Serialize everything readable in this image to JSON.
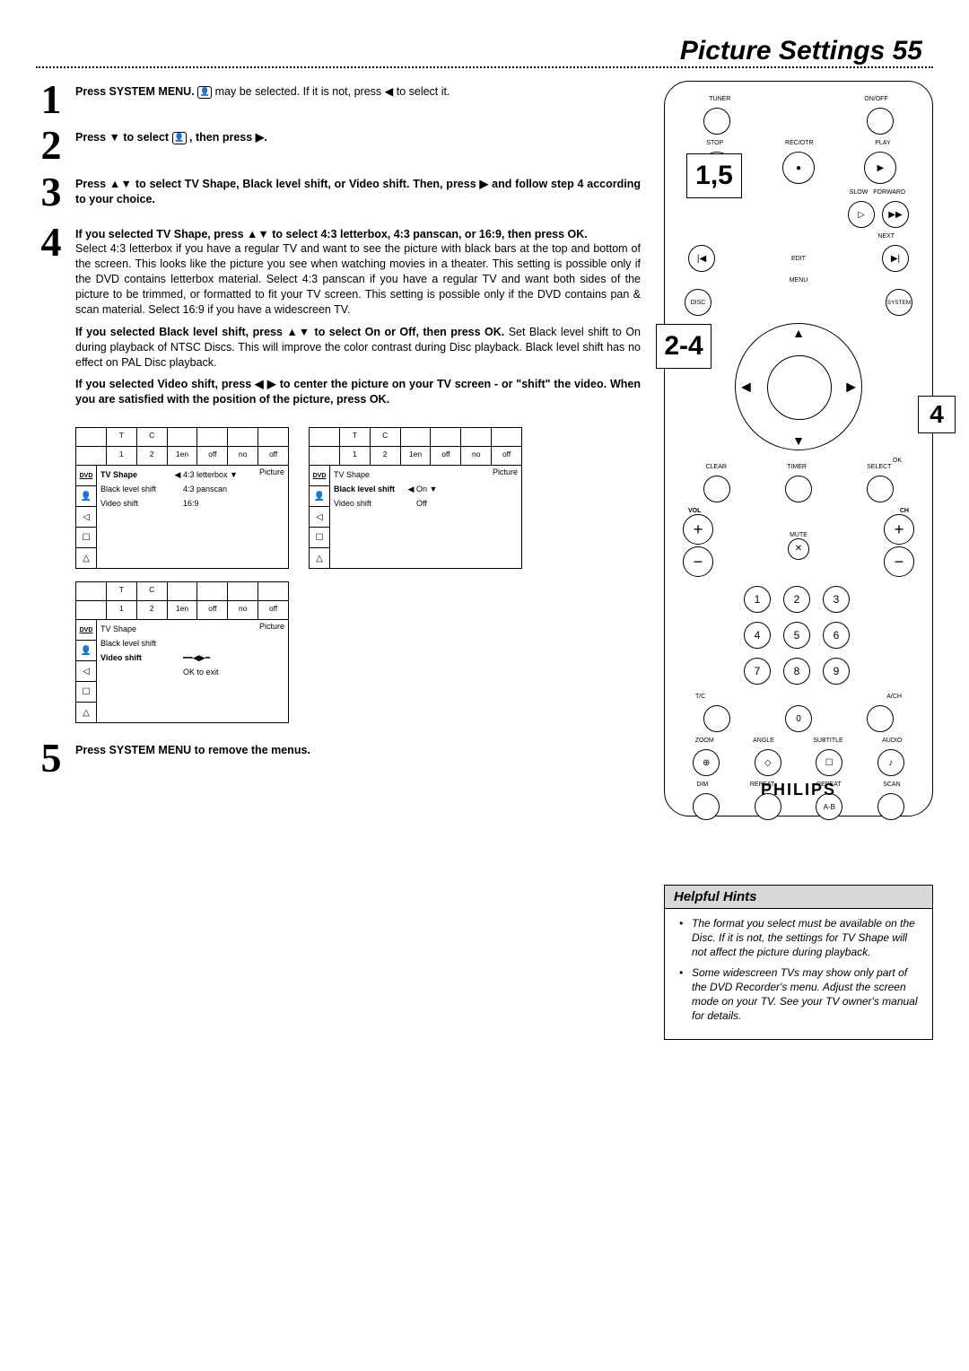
{
  "header": {
    "title": "Picture Settings",
    "page_number": "55"
  },
  "steps": {
    "s1": {
      "num": "1",
      "lead": "Press SYSTEM MENU.",
      "icon_name": "person-icon",
      "mid": " may be selected. If it is not, press ",
      "arrow": "◀",
      "tail": " to select it."
    },
    "s2": {
      "num": "2",
      "lead1": "Press ",
      "arrow1": "▼",
      "mid1": " to select ",
      "icon_box": "👤",
      "mid2": " , then press ",
      "arrow2": "▶",
      "tail": "."
    },
    "s3": {
      "num": "3",
      "lead": "Press ",
      "arrows": "▲▼",
      "mid1": " to select TV Shape, Black level shift, or Video shift. Then, press ",
      "arrow_r": "▶",
      "tail": " and follow step 4 according to your choice."
    },
    "s4": {
      "num": "4",
      "p1_lead": "If you selected TV Shape, press ",
      "p1_arrows": "▲▼",
      "p1_mid": " to select 4:3 letter­box, 4:3 panscan, or 16:9, then press OK.",
      "p1_body": "Select 4:3 letterbox if you have a regular TV and want to see the picture with black bars at the top and bottom of the screen. This looks like the picture you see when watching movies in a theater. This setting is possible only if the DVD contains letterbox material. Select 4:3 panscan if you have a regular TV and want both sides of the picture to be trimmed, or formatted to fit your TV screen. This setting is possible only if the DVD contains pan & scan material. Select 16:9 if you have a widescreen TV.",
      "p2_lead": "If you selected Black level shift, press ",
      "p2_arrows": "▲▼",
      "p2_mid": " to select On or Off, then press OK.",
      "p2_body": " Set Black level shift to On during playback of NTSC Discs. This will improve the color contrast during Disc play­back. Black level shift has no effect on PAL Disc playback.",
      "p3_lead": "If you selected Video shift, press ",
      "p3_arrows": "◀ ▶",
      "p3_mid": " to center the pic­ture on your TV screen - or \"shift\" the video. When you are satisfied with the position of the picture, press OK."
    },
    "s5": {
      "num": "5",
      "text": "Press SYSTEM MENU to remove the menus."
    }
  },
  "menu_top_cells": {
    "c1": "",
    "c2": "T",
    "c3": "C",
    "c4": "",
    "c5": "",
    "c6": "",
    "c7": ""
  },
  "menu_top_row2": {
    "c1": "",
    "c2": "1",
    "c3": "2",
    "c4": "1en",
    "c5": "off",
    "c6": "no",
    "c7": "off"
  },
  "menu_picture": "Picture",
  "menu1": {
    "items": [
      {
        "label": "TV Shape",
        "selected": true,
        "arrow": "◀",
        "val": "4:3 letterbox",
        "drop": "▼"
      },
      {
        "label": "Black level shift",
        "val": "4:3 panscan"
      },
      {
        "label": "Video shift",
        "val": "16:9"
      }
    ]
  },
  "menu2": {
    "items": [
      {
        "label": "TV Shape"
      },
      {
        "label": "Black level shift",
        "selected": true,
        "arrow": "◀",
        "val": "On",
        "drop": "▼"
      },
      {
        "label": "Video shift",
        "val": "Off"
      }
    ]
  },
  "menu3": {
    "items": [
      {
        "label": "TV Shape"
      },
      {
        "label": "Black level shift"
      },
      {
        "label": "Video shift",
        "selected": true,
        "slider": "━━◀▶━",
        "hint": "OK to exit"
      }
    ]
  },
  "remote": {
    "labels": {
      "tuner": "TUNER",
      "onoff": "ON/OFF",
      "stop": "STOP",
      "recorotr": "REC/OTR",
      "play": "PLAY",
      "slow": "SLOW",
      "forward": "FORWARD",
      "edit": "EDIT",
      "next": "NEXT",
      "menu": "MENU",
      "disc": "DISC",
      "system": "SYSTEM",
      "ok": "OK",
      "clear": "CLEAR",
      "timer": "TIMER",
      "select": "SELECT",
      "vol": "VOL",
      "ch": "CH",
      "mute": "MUTE",
      "tc": "T/C",
      "ach": "A/CH",
      "zoom": "ZOOM",
      "angle": "ANGLE",
      "subtitle": "SUBTITLE",
      "audio": "AUDIO",
      "dim": "DIM",
      "repeat": "REPEAT",
      "repeat2": "REPEAT",
      "scan": "SCAN",
      "ab": "A-B"
    },
    "numbers": {
      "n1": "1",
      "n2": "2",
      "n3": "3",
      "n4": "4",
      "n5": "5",
      "n6": "6",
      "n7": "7",
      "n8": "8",
      "n9": "9",
      "n0": "0"
    },
    "brand": "PHILIPS",
    "overlay1": "1,5",
    "overlay2": "2-4",
    "overlay3": "4",
    "glyphs": {
      "stop": "■",
      "rec": "●",
      "play": "▶",
      "slow": "▷",
      "fwd": "▶▶",
      "prev": "|◀",
      "next": "▶|",
      "plus": "+",
      "minus": "−",
      "mute": "✕",
      "zoom": "⊕",
      "angle": "◇",
      "sub": "☐",
      "audio": "♪"
    }
  },
  "hints": {
    "title": "Helpful Hints",
    "items": [
      "The format you select must be available on the Disc. If it is not, the settings for TV Shape will not affect the picture during playback.",
      "Some widescreen TVs may show only part of the DVD Recorder's menu. Adjust the screen mode on your TV. See your TV owner's manual for details."
    ]
  },
  "side_icons": {
    "dvd": "DVD",
    "disc": "◉",
    "person": "👤",
    "speak": "◁",
    "subt": "☐",
    "lock": "△"
  }
}
